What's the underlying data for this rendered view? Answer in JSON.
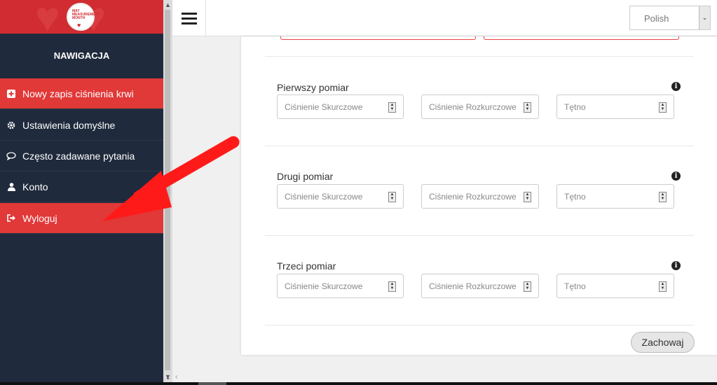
{
  "sidebar": {
    "logo_text": "MAY MEASUREMENT MONTH",
    "title": "NAWIGACJA",
    "items": [
      {
        "label": "Nowy zapis ciśnienia krwi",
        "icon": "plus-square-icon",
        "active": true
      },
      {
        "label": "Ustawienia domyślne",
        "icon": "gear-icon",
        "active": false
      },
      {
        "label": "Często zadawane pytania",
        "icon": "comment-icon",
        "active": false
      },
      {
        "label": "Konto",
        "icon": "user-icon",
        "active": false
      },
      {
        "label": "Wyloguj",
        "icon": "sign-out-icon",
        "active": true
      }
    ]
  },
  "topbar": {
    "language": "Polish"
  },
  "form": {
    "sections": [
      {
        "title": "Pierwszy pomiar",
        "fields": [
          "Ciśnienie Skurczowe",
          "Ciśnienie Rozkurczowe",
          "Tętno"
        ]
      },
      {
        "title": "Drugi pomiar",
        "fields": [
          "Ciśnienie Skurczowe",
          "Ciśnienie Rozkurczowe",
          "Tętno"
        ]
      },
      {
        "title": "Trzeci pomiar",
        "fields": [
          "Ciśnienie Skurczowe",
          "Ciśnienie Rozkurczowe",
          "Tętno"
        ]
      }
    ],
    "info_symbol": "i",
    "save_label": "Zachowaj"
  },
  "colors": {
    "sidebar_bg": "#1f2a3c",
    "accent_red": "#e13838",
    "header_red": "#d02c31"
  }
}
